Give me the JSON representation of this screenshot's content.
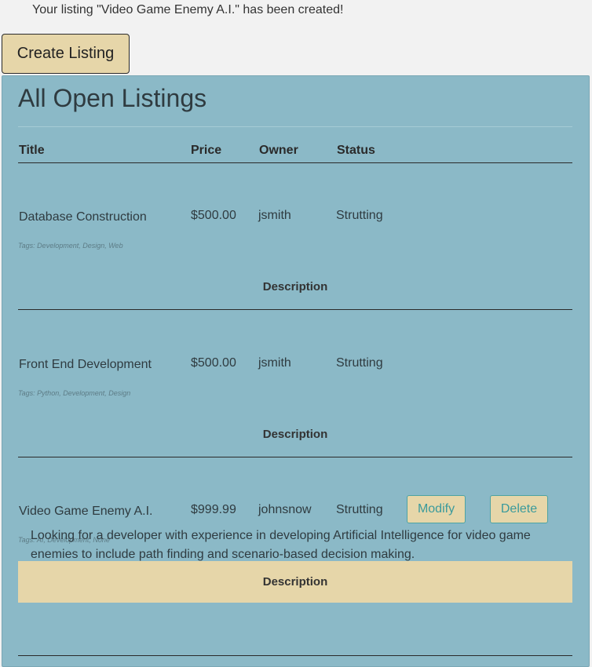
{
  "flash_message": "Your listing \"Video Game Enemy A.I.\" has been created!",
  "create_button_label": "Create Listing",
  "panel": {
    "title": "All Open Listings",
    "columns": {
      "title": "Title",
      "price": "Price",
      "owner": "Owner",
      "status": "Status"
    },
    "listings": [
      {
        "title": "Database Construction",
        "price": "$500.00",
        "owner": "jsmith",
        "status": "Strutting",
        "tags": "Tags: Development, Design, Web",
        "description_label": "Description"
      },
      {
        "title": "Front End Development",
        "price": "$500.00",
        "owner": "jsmith",
        "status": "Strutting",
        "tags": "Tags: Python, Development, Design",
        "description_label": "Description"
      },
      {
        "title": "Video Game Enemy A.I.",
        "price": "$999.99",
        "owner": "johnsnow",
        "status": "Strutting",
        "tags": "Tags: AI, Development, None",
        "description_label": "Description",
        "modify_label": "Modify",
        "delete_label": "Delete",
        "description_text": "Looking for a developer with experience in developing Artificial Intelligence for video game enemies to include path finding and scenario-based decision making."
      }
    ]
  },
  "colors": {
    "page_background": "#f2f2f2",
    "panel_background": "#8bb9c7",
    "button_background": "#e6d6a9",
    "action_text": "#3a9a9c"
  }
}
